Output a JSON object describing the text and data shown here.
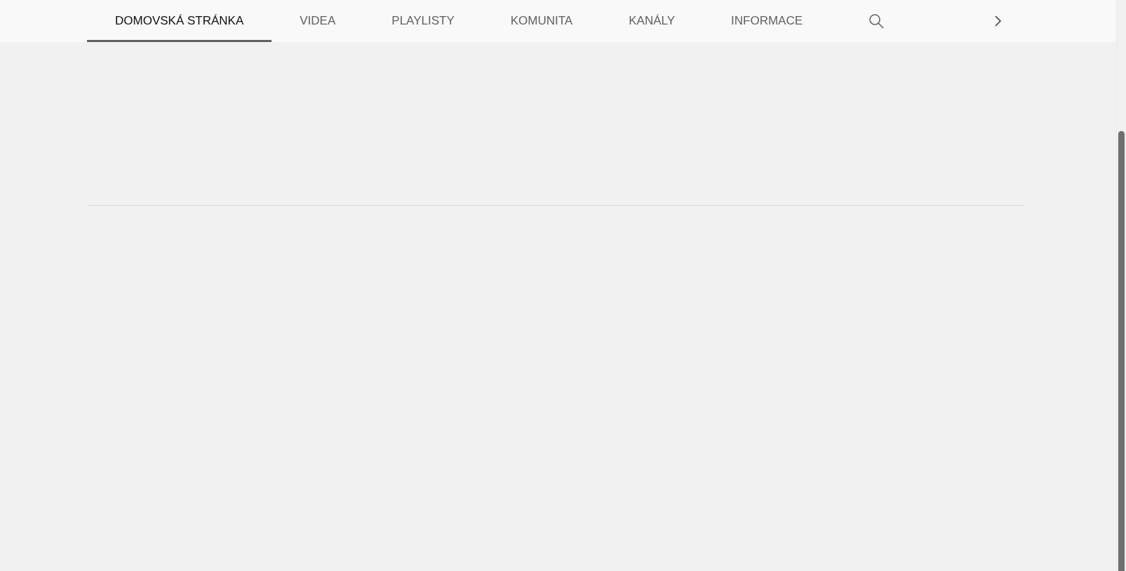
{
  "tabs": [
    {
      "label": "DOMOVSKÁ STRÁNKA",
      "selected": true
    },
    {
      "label": "VIDEA",
      "selected": false
    },
    {
      "label": "PLAYLISTY",
      "selected": false
    },
    {
      "label": "KOMUNITA",
      "selected": false
    },
    {
      "label": "KANÁLY",
      "selected": false
    },
    {
      "label": "INFORMACE",
      "selected": false
    }
  ]
}
